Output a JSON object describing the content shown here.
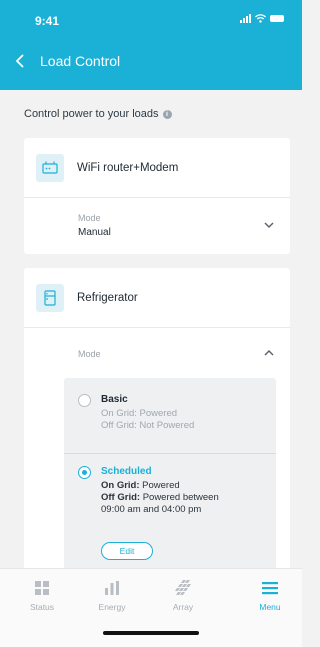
{
  "status_bar": {
    "time": "9:41"
  },
  "header": {
    "title": "Load Control"
  },
  "intro": {
    "text": "Control power to your loads"
  },
  "loads": [
    {
      "name": "WiFi router+Modem",
      "mode_label": "Mode",
      "mode_value": "Manual",
      "expanded": false
    },
    {
      "name": "Refrigerator",
      "mode_label": "Mode",
      "expanded": true,
      "options": [
        {
          "title": "Basic",
          "selected": false,
          "on_grid_label": "On Grid:",
          "on_grid_value": "Powered",
          "off_grid_label": "Off Grid:",
          "off_grid_value": "Not Powered"
        },
        {
          "title": "Scheduled",
          "selected": true,
          "on_grid_label": "On Grid:",
          "on_grid_value": "Powered",
          "off_grid_label": "Off Grid:",
          "off_grid_value": "Powered between",
          "off_grid_value_2": "09:00 am and 04:00 pm",
          "edit_label": "Edit"
        }
      ]
    }
  ],
  "tabbar": {
    "tabs": [
      {
        "label": "Status",
        "icon": "status-grid-icon",
        "active": false
      },
      {
        "label": "Energy",
        "icon": "energy-bars-icon",
        "active": false
      },
      {
        "label": "Array",
        "icon": "array-panels-icon",
        "active": false
      },
      {
        "label": "Menu",
        "icon": "menu-icon",
        "active": true
      }
    ]
  },
  "colors": {
    "accent": "#1bb1d6",
    "background": "#f2f2f2",
    "card": "#ffffff",
    "options_bg": "#eef0f2"
  }
}
